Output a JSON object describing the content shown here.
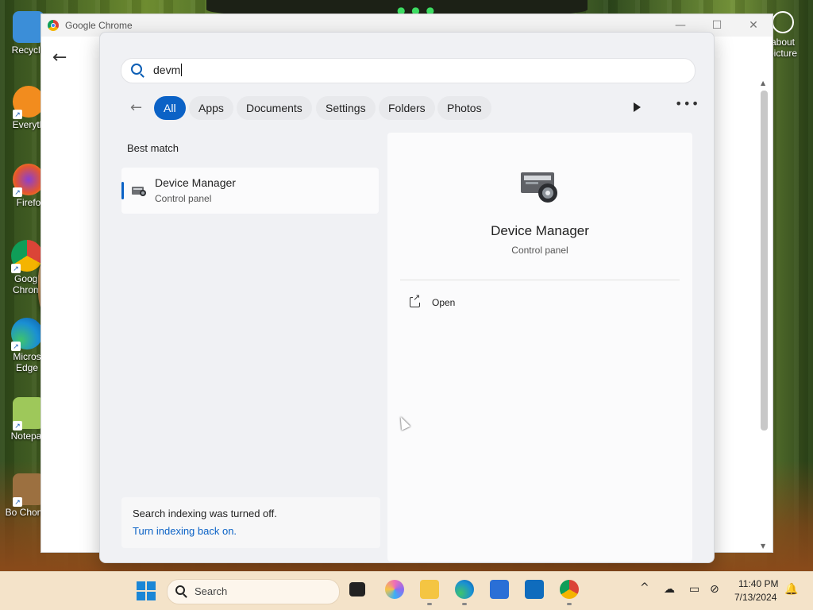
{
  "desktop": {
    "icons": [
      {
        "label": "Recycle",
        "color": "#3b8ed8"
      },
      {
        "label": "Everyth",
        "color": "#f28c1e"
      },
      {
        "label": "Firefo",
        "color": "#e5562e"
      },
      {
        "label": "Googl Chrom",
        "color": "#db4437"
      },
      {
        "label": "Micros Edge",
        "color": "#1a8fd4"
      },
      {
        "label": "Notepac",
        "color": "#9ec85a"
      },
      {
        "label": "Bo Chomik",
        "color": "#9c7040"
      }
    ],
    "right_icon_label": "about picture"
  },
  "chrome": {
    "title": "Google Chrome",
    "minimize": "—",
    "maximize": "☐",
    "close": "✕",
    "back": "←"
  },
  "search": {
    "query": "devm",
    "filters": {
      "back": "←",
      "items": [
        "All",
        "Apps",
        "Documents",
        "Settings",
        "Folders",
        "Photos"
      ],
      "active": "All"
    },
    "best_match_label": "Best match",
    "result": {
      "title": "Device Manager",
      "subtitle": "Control panel"
    },
    "notice": {
      "text": "Search indexing was turned off.",
      "link": "Turn indexing back on."
    },
    "preview": {
      "title": "Device Manager",
      "subtitle": "Control panel",
      "action_label": "Open"
    }
  },
  "taskbar": {
    "search_label": "Search",
    "time": "11:40 PM",
    "date": "7/13/2024",
    "tray_chevron": "^"
  },
  "colors": {
    "accent": "#0b62c6",
    "taskbar": "#f4e3c9"
  }
}
